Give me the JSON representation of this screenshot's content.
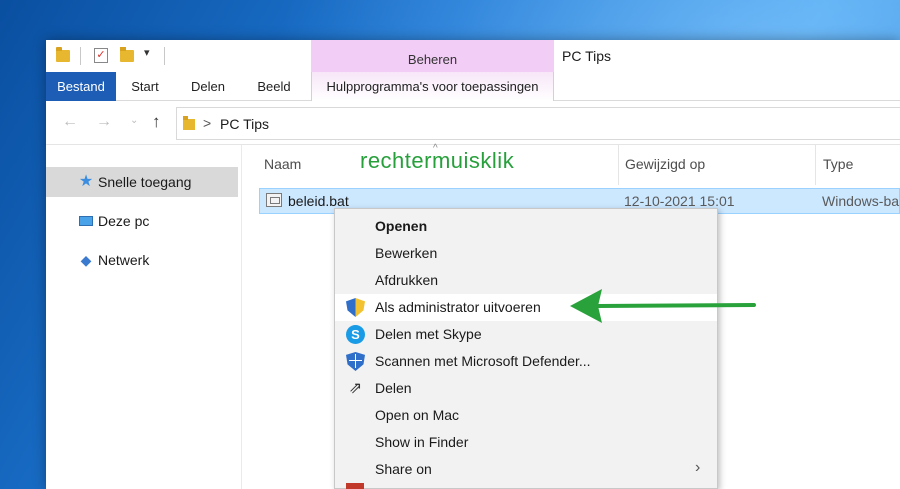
{
  "titlebar": {
    "contextual_group": "Beheren",
    "window_title": "PC Tips",
    "qa_dropdown": "▾"
  },
  "ribbon": {
    "tabs": [
      {
        "id": "file",
        "label": "Bestand"
      },
      {
        "id": "start",
        "label": "Start"
      },
      {
        "id": "share",
        "label": "Delen"
      },
      {
        "id": "view",
        "label": "Beeld"
      },
      {
        "id": "manage",
        "label": "Hulpprogramma's voor toepassingen"
      }
    ],
    "accent_color": "#1e5db5",
    "contextual_color": "#f2cdf5"
  },
  "address": {
    "back": "←",
    "forward": "→",
    "recent": "⌄",
    "up": "↑",
    "chevron": ">",
    "path": "PC Tips"
  },
  "navpane": {
    "items": [
      {
        "label": "Snelle toegang",
        "icon": "star-icon",
        "selected": true
      },
      {
        "label": "Deze pc",
        "icon": "pc-icon",
        "selected": false
      },
      {
        "label": "Netwerk",
        "icon": "network-icon",
        "selected": false
      }
    ]
  },
  "filelist": {
    "columns": [
      "Naam",
      "Gewijzigd op",
      "Type"
    ],
    "annotation": "rechtermuisklik",
    "annotation_color": "#27a03c",
    "rows": [
      {
        "name": "beleid.bat",
        "modified": "12-10-2021 15:01",
        "type": "Windows-ba",
        "selected": true
      }
    ]
  },
  "context_menu": {
    "items": [
      {
        "label": "Openen",
        "bold": true,
        "icon": ""
      },
      {
        "label": "Bewerken",
        "icon": ""
      },
      {
        "label": "Afdrukken",
        "icon": ""
      },
      {
        "label": "Als administrator uitvoeren",
        "icon": "uac-shield-icon",
        "highlighted": true
      },
      {
        "label": "Delen met Skype",
        "icon": "skype-icon"
      },
      {
        "label": "Scannen met Microsoft Defender...",
        "icon": "defender-icon"
      },
      {
        "label": "Delen",
        "icon": "share-icon"
      },
      {
        "label": "Open on Mac",
        "icon": ""
      },
      {
        "label": "Show in Finder",
        "icon": ""
      },
      {
        "label": "Share on",
        "icon": "",
        "submenu": true
      }
    ],
    "skype_glyph": "S",
    "share_glyph": "⇗",
    "submenu_glyph": "›"
  },
  "arrow_color": "#2aa23c"
}
